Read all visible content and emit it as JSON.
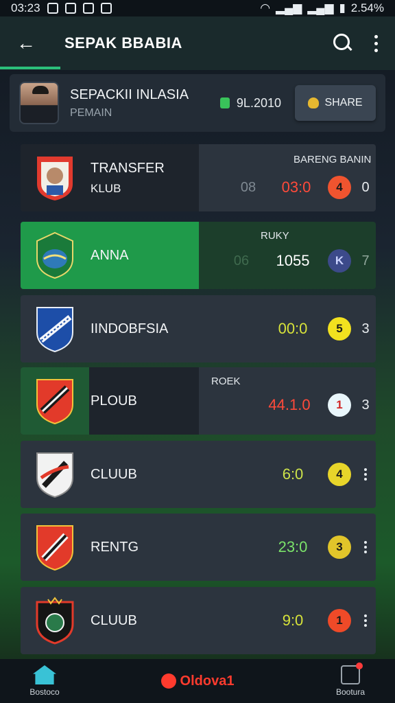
{
  "status": {
    "time": "03:23",
    "battery": "2.54%"
  },
  "appbar": {
    "title": "SEPAK BBABIA"
  },
  "profile": {
    "name": "SEPACKII INLASIA",
    "subtitle": "PEMAIN",
    "stat": "9L.2010",
    "share_label": "SHARE"
  },
  "list": {
    "header_top": "BARENG BANIN",
    "header_anna": "RUKY",
    "header_plub": "ROEK",
    "rows": [
      {
        "name": "TRANSFER",
        "sub": "KLUB",
        "muted": "08",
        "score": "03:0",
        "score_color": "#ff4a3a",
        "badge": "4",
        "badge_bg": "#f0542f",
        "badge_fg": "#1a1a1a",
        "rank": "0"
      },
      {
        "name": "ANNA",
        "muted": "06",
        "score": "1055",
        "score_color": "#ffffff",
        "badge": "K",
        "badge_bg": "#3c4a8a",
        "badge_fg": "#cbd3ff",
        "rank": "7"
      },
      {
        "name": "IINDOBFSIA",
        "score": "00:0",
        "score_color": "#d8e33a",
        "badge": "5",
        "badge_bg": "#f2e11f",
        "badge_fg": "#1a1a1a",
        "rank": "3"
      },
      {
        "name": "PLOUB",
        "score": "44.1.0",
        "score_color": "#ff4a3a",
        "badge": "1",
        "badge_bg": "#e9f6fb",
        "badge_fg": "#d12626",
        "rank": "3"
      },
      {
        "name": "CLUUB",
        "score": "6:0",
        "score_color": "#cde34a",
        "badge": "4",
        "badge_bg": "#e8d52a",
        "badge_fg": "#1a1a1a"
      },
      {
        "name": "RENTG",
        "score": "23:0",
        "score_color": "#7be36a",
        "badge": "3",
        "badge_bg": "#e1c52a",
        "badge_fg": "#1a1a1a"
      },
      {
        "name": "CLUUB",
        "score": "9:0",
        "score_color": "#d7e33a",
        "badge": "1",
        "badge_bg": "#ef4a28",
        "badge_fg": "#1a1a1a"
      }
    ]
  },
  "bottom_nav": {
    "home_label": "Bostoco",
    "brand": "Oldova1",
    "right_label": "Bootura"
  },
  "colors": {
    "accent": "#2bbf7a",
    "highlight": "#1f9a4a"
  }
}
